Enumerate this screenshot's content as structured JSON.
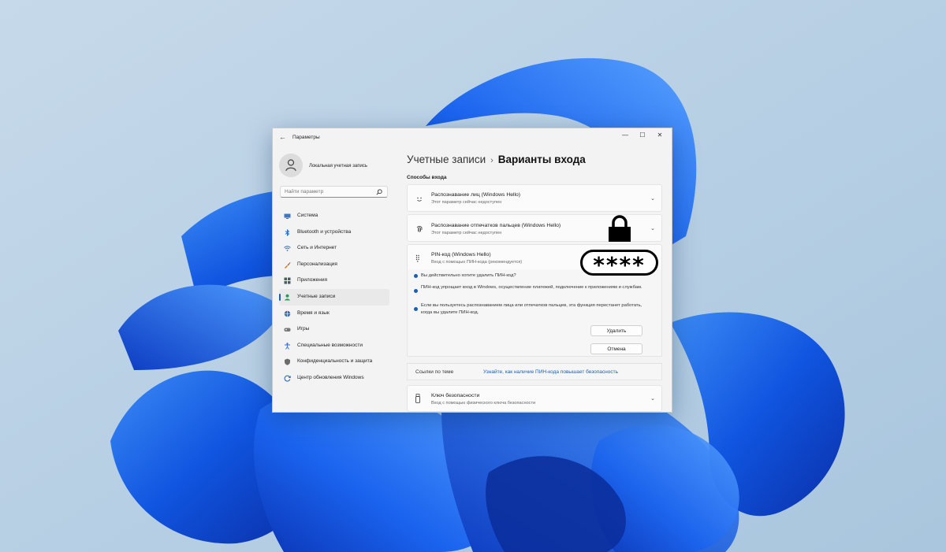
{
  "window": {
    "title": "Параметры",
    "controls": {
      "minimize": "—",
      "maximize": "☐",
      "close": "✕"
    }
  },
  "profile": {
    "name": "Локальная учетная запись"
  },
  "search": {
    "placeholder": "Найти параметр"
  },
  "nav": {
    "items": [
      {
        "label": "Система",
        "icon": "monitor-icon",
        "color": "#3b78c4"
      },
      {
        "label": "Bluetooth и устройства",
        "icon": "bluetooth-icon",
        "color": "#2e6fc0"
      },
      {
        "label": "Сеть и Интернет",
        "icon": "wifi-icon",
        "color": "#2e6fc0"
      },
      {
        "label": "Персонализация",
        "icon": "brush-icon",
        "color": "#d47a1e"
      },
      {
        "label": "Приложения",
        "icon": "apps-icon",
        "color": "#4a5a6e"
      },
      {
        "label": "Учетные записи",
        "icon": "person-icon",
        "color": "#2b9a5a",
        "active": true
      },
      {
        "label": "Время и язык",
        "icon": "globe-icon",
        "color": "#2e6fc0"
      },
      {
        "label": "Игры",
        "icon": "gamepad-icon",
        "color": "#777777"
      },
      {
        "label": "Специальные возможности",
        "icon": "accessibility-icon",
        "color": "#2e6fc0"
      },
      {
        "label": "Конфиденциальность и защита",
        "icon": "shield-icon",
        "color": "#6b6b6b"
      },
      {
        "label": "Центр обновления Windows",
        "icon": "update-icon",
        "color": "#2e6fc0"
      }
    ]
  },
  "breadcrumb": {
    "parent": "Учетные записи",
    "separator": "›",
    "current": "Варианты входа"
  },
  "section": {
    "label": "Способы входа"
  },
  "cards": {
    "face": {
      "title": "Распознавание лиц (Windows Hello)",
      "subtitle": "Этот параметр сейчас недоступен",
      "icon": "face-icon"
    },
    "fingerprint": {
      "title": "Распознавание отпечатков пальцев (Windows Hello)",
      "subtitle": "Этот параметр сейчас недоступен",
      "icon": "fingerprint-icon"
    },
    "pin": {
      "title": "PIN-код (Windows Hello)",
      "subtitle": "Вход с помощью ПИН-кода (рекомендуется)",
      "icon": "keypad-icon"
    },
    "key": {
      "title": "Ключ безопасности",
      "subtitle": "Вход с помощью физического ключа безопасности",
      "icon": "usb-key-icon"
    }
  },
  "pin_panel": {
    "question": "Вы действительно хотите удалить ПИН-код?",
    "info1": "ПИН-код упрощает вход в Windows, осуществление платежей, подключение к приложениям и службам.",
    "info2": "Если вы пользуетесь распознаванием лица или отпечатков пальцев, эта функция перестанет работать, когда вы удалите ПИН-код.",
    "remove_button": "Удалить",
    "cancel_button": "Отмена"
  },
  "related": {
    "label": "Ссылки по теме",
    "link": "Узнайте, как наличие ПИН-кода повышает безопасность"
  },
  "overlay": {
    "password_mask": "****"
  },
  "colors": {
    "accent": "#1a5fb4"
  }
}
